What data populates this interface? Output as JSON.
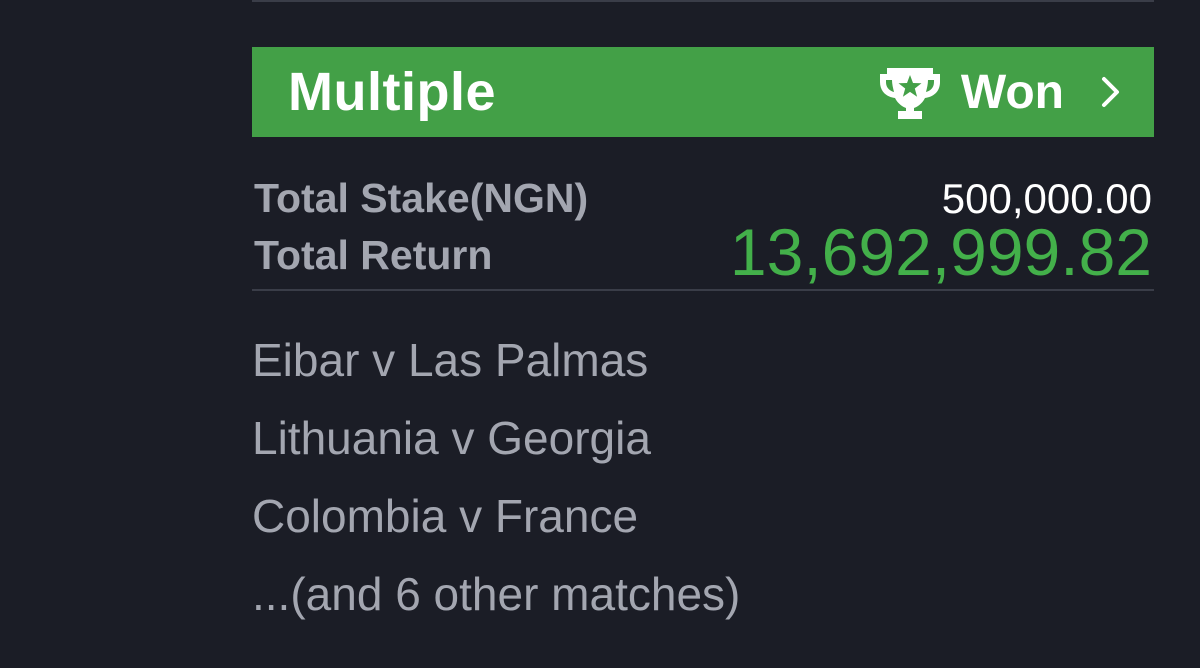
{
  "bet": {
    "type": "Multiple",
    "status": "Won",
    "status_icon": "trophy-icon",
    "status_color": "#43a047",
    "total_stake_label": "Total Stake(NGN)",
    "total_stake_value": "500,000.00",
    "total_return_label": "Total Return",
    "total_return_value": "13,692,999.82",
    "return_color": "#43b04a"
  },
  "matches": [
    "Eibar v Las Palmas",
    "Lithuania v Georgia",
    "Colombia v France",
    "...(and 6 other matches)"
  ]
}
